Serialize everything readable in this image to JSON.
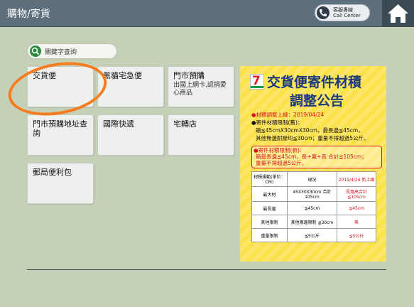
{
  "header": {
    "title": "購物/寄貨",
    "call_center_zh": "客服專線",
    "call_center_en": "Call Center"
  },
  "search": {
    "placeholder": "關鍵字查詢"
  },
  "tiles": {
    "t1": "交貨便",
    "t2": "黑貓宅急便",
    "t3_label": "門市預購",
    "t3_sub": "出國上網卡,認捐愛心商品",
    "t4": "門市預購地址查詢",
    "t5": "國際快遞",
    "t6": "宅轉店",
    "t7": "郵局便利包"
  },
  "poster": {
    "logo_text": "7",
    "title_line1": "交貨便寄件材積",
    "title_line2": "調整公告",
    "line1": "●材積調整上線：2019/04/24",
    "line2": "●寄件材積限制(舊)：",
    "line3": "箱≦45cmX30cmX30cm，最長邊≦45cm，",
    "line4": "其他無邊耐壓均≦30cm；重量不得超過5公斤。",
    "line5": "●寄件材積限制(新)：",
    "line6": "箱最長邊≦45cm，長+寬+高 合計≦105cm；",
    "line7": "重量不得超過5公斤。",
    "table": {
      "header": [
        "材積規範(單位：CM)",
        "現況",
        "2019/4/24 新上線"
      ],
      "rows": [
        [
          "最大材",
          "45X30X30cm 合計105cm",
          "長寬高合計 ≦105cm"
        ],
        [
          "最長邊",
          "≦45cm",
          "≦45cm"
        ],
        [
          "其他限制",
          "其他兩邊限制 ≦30cm",
          "無"
        ],
        [
          "重量限制",
          "≦5公斤",
          "≦5公斤"
        ]
      ]
    }
  }
}
